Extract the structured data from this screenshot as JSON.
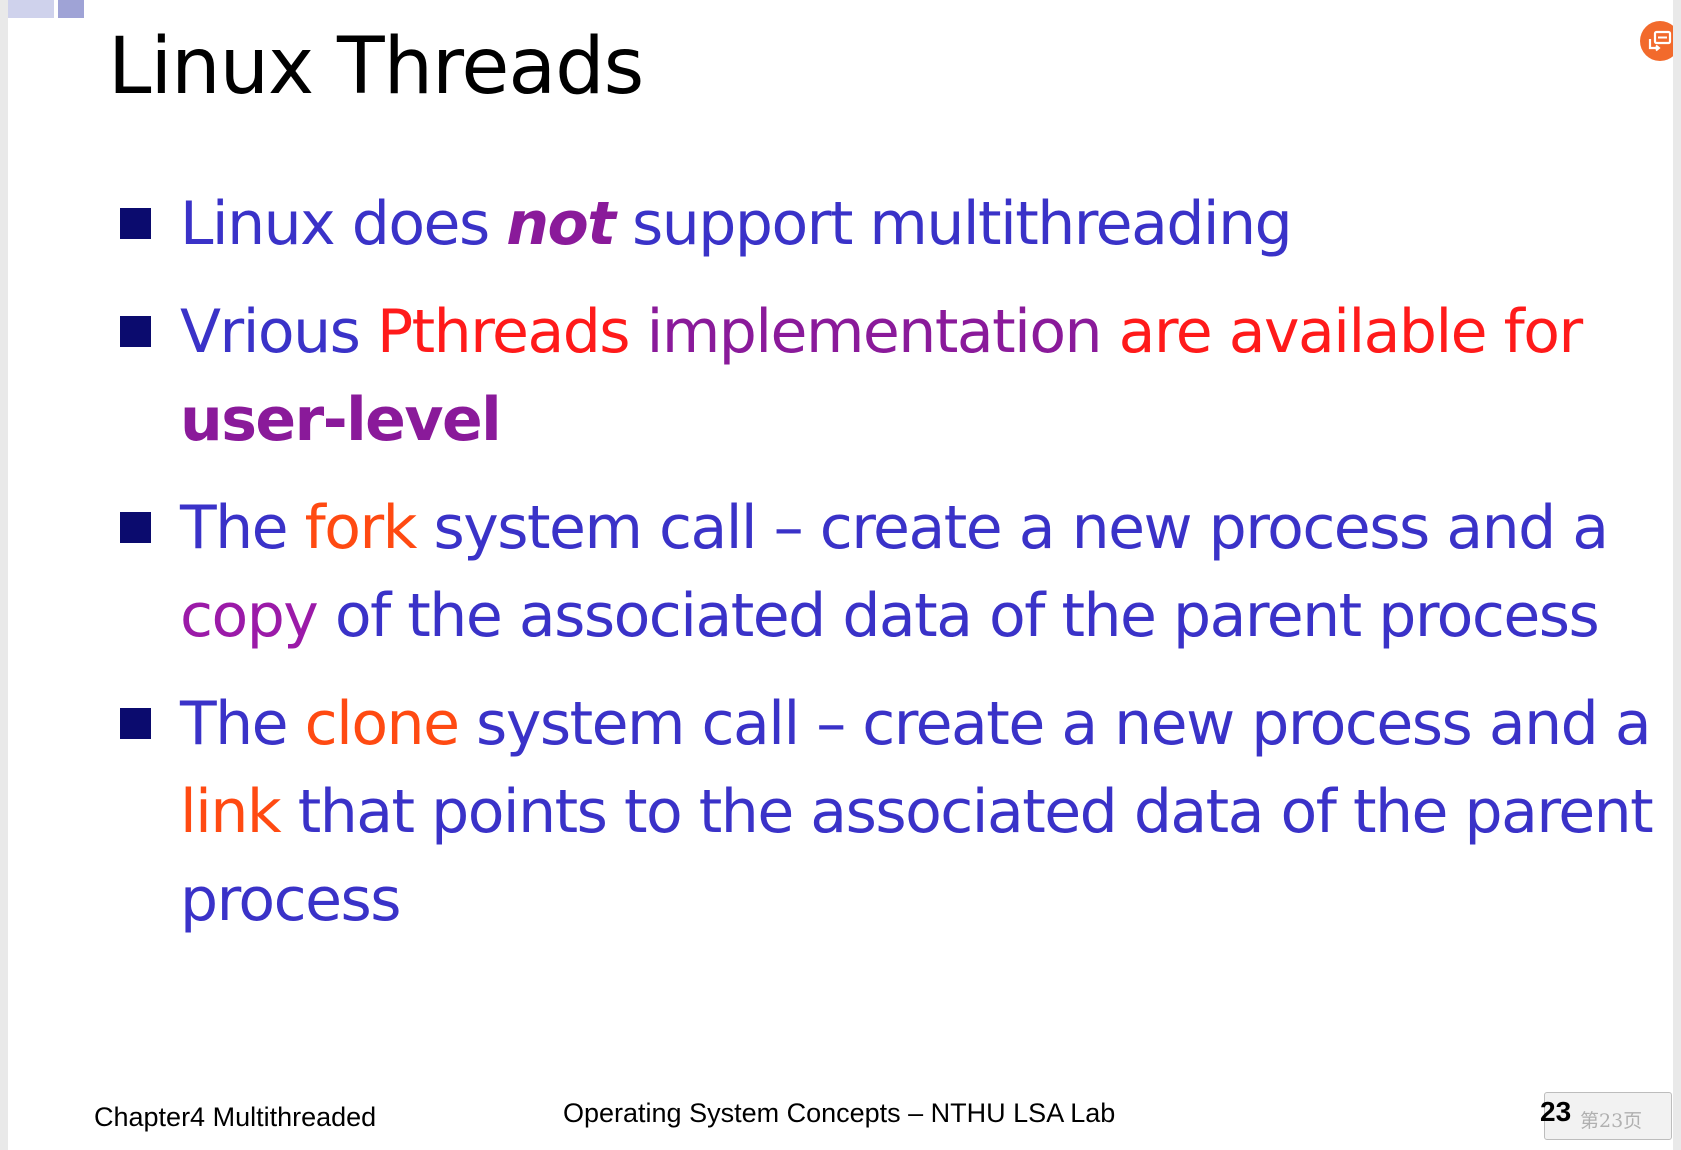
{
  "slide": {
    "title": "Linux Threads",
    "bullets": [
      {
        "segments": [
          {
            "text": "Linux does ",
            "color": "#3a32c8",
            "style": "normal"
          },
          {
            "text": "not",
            "color": "#8a1a9a",
            "style": "bold-italic"
          },
          {
            "text": " support multithreading",
            "color": "#3a32c8",
            "style": "normal"
          }
        ]
      },
      {
        "segments": [
          {
            "text": "Vrious ",
            "color": "#3a32c8",
            "style": "normal"
          },
          {
            "text": "Pthreads",
            "color": "#ff1a1a",
            "style": "normal"
          },
          {
            "text": " implementation",
            "color": "#8a1a9a",
            "style": "normal"
          },
          {
            "text": " are available for",
            "color": "#ff1a1a",
            "style": "normal"
          },
          {
            "text": " user-level",
            "color": "#8a1a9a",
            "style": "bold"
          }
        ]
      },
      {
        "segments": [
          {
            "text": "The ",
            "color": "#3a32c8",
            "style": "normal"
          },
          {
            "text": "fork",
            "color": "#ff4a12",
            "style": "normal"
          },
          {
            "text": " system call – create a new process and a ",
            "color": "#3a32c8",
            "style": "normal"
          },
          {
            "text": "copy",
            "color": "#9b1aa8",
            "style": "normal"
          },
          {
            "text": " of the associated data of the parent process",
            "color": "#3a32c8",
            "style": "normal"
          }
        ]
      },
      {
        "segments": [
          {
            "text": "The ",
            "color": "#3a32c8",
            "style": "normal"
          },
          {
            "text": "clone",
            "color": "#ff4a12",
            "style": "normal"
          },
          {
            "text": " system call – create a new process and a ",
            "color": "#3a32c8",
            "style": "normal"
          },
          {
            "text": "link",
            "color": "#ff4a12",
            "style": "normal"
          },
          {
            "text": " that points to the associated data of the parent process",
            "color": "#3a32c8",
            "style": "normal"
          }
        ]
      }
    ]
  },
  "footer": {
    "chapter": "Chapter4 Multithreaded",
    "course": "Operating System Concepts – NTHU LSA Lab",
    "page_number": "23",
    "page_label": "第23页"
  },
  "colors": {
    "bullet_marker": "#0b0b6e",
    "accent_button": "#f26a2c"
  },
  "icons": {
    "float_button": "presentation-icon"
  }
}
